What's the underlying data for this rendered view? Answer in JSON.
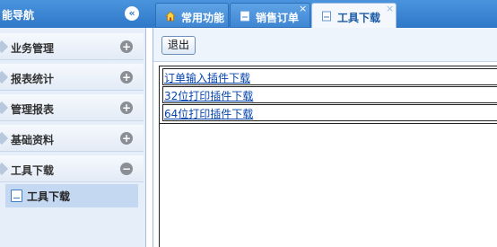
{
  "nav": {
    "title": "能导航",
    "collapse_icon": "«"
  },
  "tabs": [
    {
      "label": "常用功能",
      "icon": "home-icon",
      "closable": false,
      "active": false
    },
    {
      "label": "销售订单",
      "icon": "document-icon",
      "closable": true,
      "active": false
    },
    {
      "label": "工具下载",
      "icon": "document-icon",
      "closable": true,
      "active": true
    }
  ],
  "tab_close_glyph": "×",
  "sidebar": {
    "items": [
      {
        "label": "业务管理",
        "toggle": "+"
      },
      {
        "label": "报表统计",
        "toggle": "+"
      },
      {
        "label": "管理报表",
        "toggle": "+"
      },
      {
        "label": "基础资料",
        "toggle": "+"
      },
      {
        "label": "工具下载",
        "toggle": "−"
      }
    ],
    "subitem": {
      "label": "工具下载"
    }
  },
  "toolbar": {
    "exit_label": "退出"
  },
  "links": [
    "订单输入插件下载",
    "32位打印插件下载",
    "64位打印插件下载"
  ],
  "colors": {
    "header_blue": "#2f78c8",
    "link_blue": "#0645ad",
    "sidebar_bg": "#e6eef9"
  }
}
